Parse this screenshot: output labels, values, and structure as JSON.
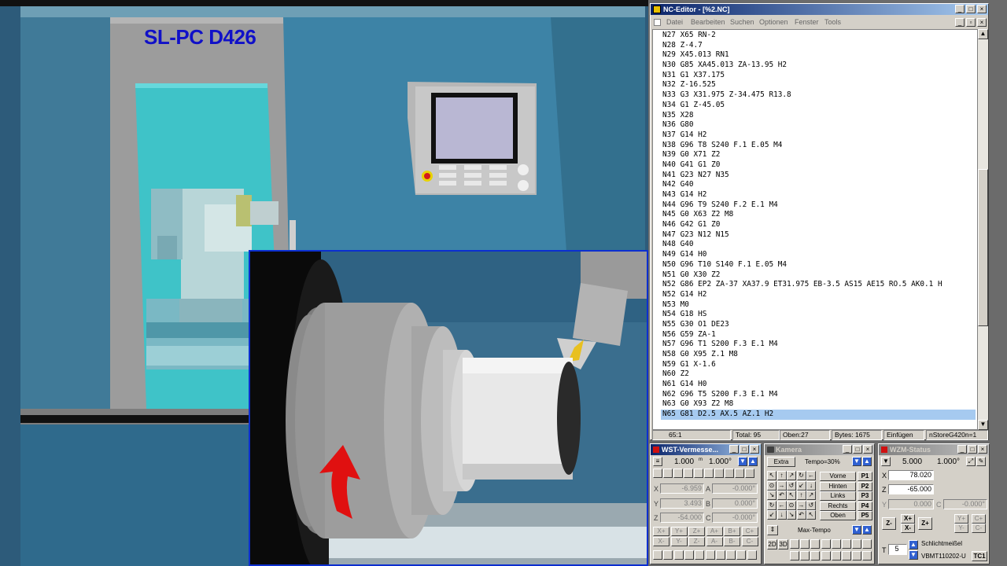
{
  "viewport": {
    "machine_label": "SL-PC D426"
  },
  "nc_editor": {
    "title": "NC-Editor - [%2.NC]",
    "menu": [
      "Datei",
      "Bearbeiten",
      "Suchen",
      "Optionen",
      "Fenster",
      "Tools"
    ],
    "lines": [
      "N27 X65 RN-2",
      "N28 Z-4.7",
      "N29 X45.013 RN1",
      "N30 G85 XA45.013 ZA-13.95 H2",
      "N31 G1 X37.175",
      "N32 Z-16.525",
      "N33 G3 X31.975 Z-34.475 R13.8",
      "N34 G1 Z-45.05",
      "N35 X28",
      "N36 G80",
      "N37 G14 H2",
      "N38 G96 T8 S240 F.1 E.05 M4",
      "N39 G0 X71 Z2",
      "N40 G41 G1 Z0",
      "N41 G23 N27 N35",
      "N42 G40",
      "N43 G14 H2",
      "N44 G96 T9 S240 F.2 E.1 M4",
      "N45 G0 X63 Z2 M8",
      "N46 G42 G1 Z0",
      "N47 G23 N12 N15",
      "N48 G40",
      "N49 G14 H0",
      "N50 G96 T10 S140 F.1 E.05 M4",
      "N51 G0 X30 Z2",
      "N52 G86 EP2 ZA-37 XA37.9 ET31.975 EB-3.5 AS15 AE15 RO.5 AK0.1 H",
      "N52 G14 H2",
      "N53 M0",
      "N54 G18 HS",
      "N55 G30 O1 DE23",
      "N56 G59 ZA-1",
      "N57 G96 T1 S200 F.3 E.1 M4",
      "N58 G0 X95 Z.1 M8",
      "N59 G1 X-1.6",
      "N60 Z2",
      "N61 G14 H0",
      "N62 G96 T5 S200 F.3 E.1 M4",
      "N63 G0 X93 Z2 M8",
      "N65 G81 D2.5 AX.5 AZ.1 H2"
    ],
    "selected_line": "N65 G81 D2.5 AX.5 AZ.1 H2",
    "status": {
      "pos": "65:1",
      "total": "Total: 95",
      "oben": "Oben:27",
      "bytes": "Bytes: 1675",
      "mode": "Einfügen",
      "store": "nStoreG420n=1"
    }
  },
  "wst": {
    "title": "WST-Vermesse...",
    "step": "1.000",
    "step_unit": "m",
    "angle": "1.000°",
    "rows": [
      {
        "label": "X",
        "value": "-6.959",
        "axis": "A",
        "axis_value": "-0.000°"
      },
      {
        "label": "Y",
        "value": "3.493",
        "axis": "B",
        "axis_value": "0.000°"
      },
      {
        "label": "Z",
        "value": "-54.000",
        "axis": "C",
        "axis_value": "-0.000°"
      }
    ],
    "jog": [
      "X+",
      "Y+",
      "Z+",
      "A+",
      "B+",
      "C+",
      "X-",
      "Y-",
      "Z-",
      "A-",
      "B-",
      "C-"
    ]
  },
  "kamera": {
    "title": "Kamera",
    "extra": "Extra",
    "tempo": "Tempo=30%",
    "views": [
      {
        "label": "Vorne",
        "key": "P1"
      },
      {
        "label": "Hinten",
        "key": "P2"
      },
      {
        "label": "Links",
        "key": "P3"
      },
      {
        "label": "Rechts",
        "key": "P4"
      },
      {
        "label": "Oben",
        "key": "P5"
      }
    ],
    "max_tempo": "Max-Tempo",
    "mode_2d": "2D",
    "mode_3d": "3D"
  },
  "wzm": {
    "title": "WZM-Status",
    "step": "5.000",
    "angle": "1.000°",
    "x": "78.020",
    "z": "-65.000",
    "y": "0.000",
    "c": "-0.000°",
    "jog": [
      "Z-",
      "X+",
      "X-",
      "Z+",
      "Y+",
      "C+",
      "Y-",
      "C-"
    ],
    "tool_no": "5",
    "tool_t": "T",
    "tool_name": "Schlichtmeißel",
    "tool_code": "VBMT110202-U",
    "tool_tc": "TC1"
  },
  "colors": {
    "accent": "#0a246a",
    "selection": "#a6caf0",
    "machine_label": "#1010c8"
  }
}
